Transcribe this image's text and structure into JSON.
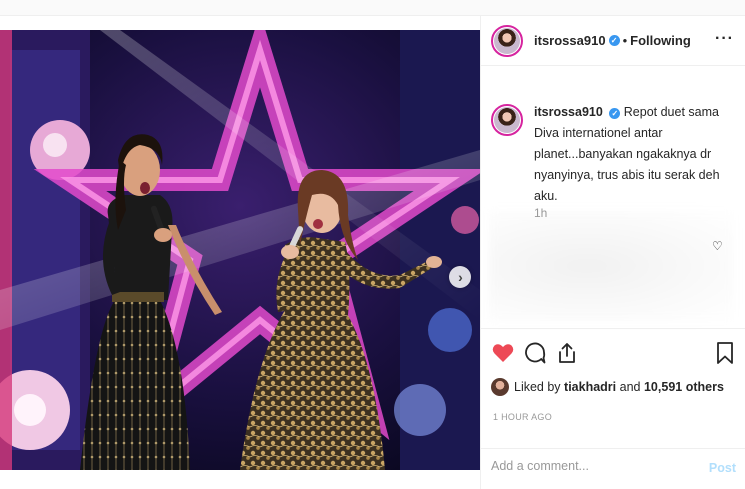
{
  "photo": {
    "alt": "Two singers performing on stage with microphones",
    "next_icon": "chevron-right-icon",
    "carousel_index": 1,
    "carousel_count": 2
  },
  "header": {
    "username": "itsrossa910",
    "verified_icon": "verified-badge-icon",
    "separator": "•",
    "follow_label": "Following",
    "more_label": "···"
  },
  "caption": {
    "username": "itsrossa910",
    "text": "Repot duet sama Diva internationel antar planet...banyakan ngakaknya dr nyanyinya, trus abis itu serak deh aku.",
    "time": "1h"
  },
  "actions": {
    "like_icon": "heart-filled-icon",
    "comment_icon": "comment-icon",
    "share_icon": "share-icon",
    "save_icon": "bookmark-icon",
    "like_color": "#ed4956"
  },
  "likes": {
    "prefix": "Liked by ",
    "first_user": "tiakhadri",
    "middle": " and ",
    "others": "10,591 others"
  },
  "timestamp": "1 HOUR AGO",
  "comment": {
    "placeholder": "Add a comment...",
    "post_label": "Post"
  }
}
